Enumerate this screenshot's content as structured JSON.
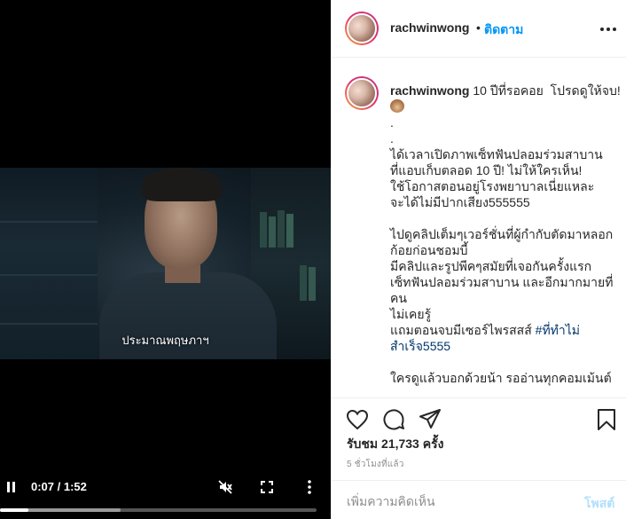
{
  "video": {
    "subtitle": "ประมาณพฤษภาฯ",
    "time": "0:07 / 1:52",
    "progress_played": 0.09,
    "progress_buffered": 0.38
  },
  "header": {
    "username": "rachwinwong",
    "separator": "•",
    "follow_label": "ติดตาม"
  },
  "post": {
    "username": "rachwinwong",
    "caption_first": " 10 ปีที่รอคอย  โปรดดูให้จบ! ",
    "caption_body": ".\n.\nได้เวลาเปิดภาพเซ็ทฟันปลอมร่วมสาบาน\nที่แอบเก็บตลอด 10 ปี! ไม่ให้ใครเห็น!\nใช้โอกาสตอนอยู่โรงพยาบาลเนี่ยแหละ\nจะได้ไม่มีปากเสียง555555\n\nไปดูคลิปเต็มๆเวอร์ชั่นที่ผู้กำกับตัดมาหลอก\nก้อยก่อนชอมบี้\nมีคลิปและรูปพีคๆสมัยที่เจอกันครั้งแรก\nเซ็ทฟันปลอมร่วมสาบาน และอีกมากมายที่คน\nไม่เคยรู้\nแถมตอนจบมีเซอร์ไพรสสส์ ",
    "hashtag": "#ที่ทำไม่สำเร็จ5555",
    "caption_end": "\n\nใครดูแล้วบอกด้วยน้า รออ่านทุกคอมเม้นต์"
  },
  "stats": {
    "views": "รับชม 21,733 ครั้ง",
    "time_ago": "5 ชั่วโมงที่แล้ว"
  },
  "comment_box": {
    "placeholder": "เพิ่มความคิดเห็น",
    "post_label": "โพสต์"
  },
  "colors": {
    "accent": "#0095f6",
    "post_disabled": "#b2dffc",
    "hashtag": "#00376b"
  }
}
